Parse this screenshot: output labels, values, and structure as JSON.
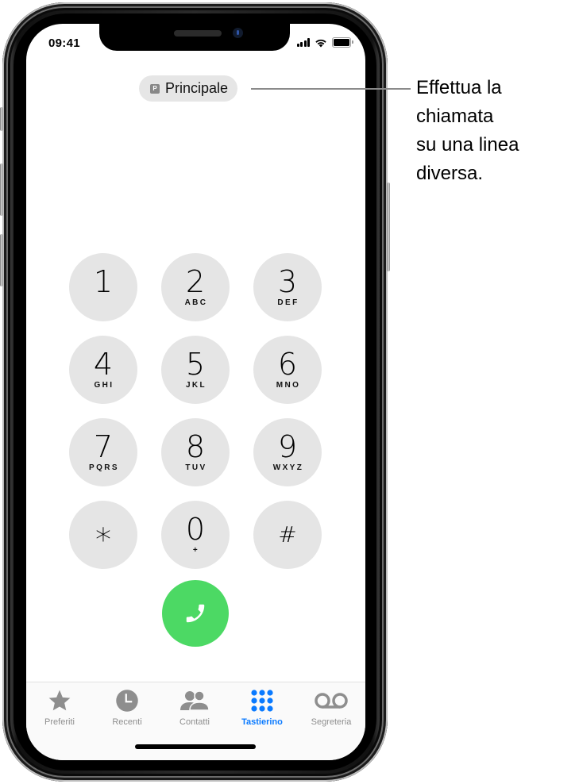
{
  "status_bar": {
    "time": "09:41",
    "icons": [
      "signal-icon",
      "wifi-icon",
      "battery-icon"
    ]
  },
  "line_selector": {
    "badge": "P",
    "label": "Principale"
  },
  "keypad": {
    "keys": [
      {
        "digit": "1",
        "letters": ""
      },
      {
        "digit": "2",
        "letters": "ABC"
      },
      {
        "digit": "3",
        "letters": "DEF"
      },
      {
        "digit": "4",
        "letters": "GHI"
      },
      {
        "digit": "5",
        "letters": "JKL"
      },
      {
        "digit": "6",
        "letters": "MNO"
      },
      {
        "digit": "7",
        "letters": "PQRS"
      },
      {
        "digit": "8",
        "letters": "TUV"
      },
      {
        "digit": "9",
        "letters": "WXYZ"
      },
      {
        "digit": "*",
        "letters": ""
      },
      {
        "digit": "0",
        "letters": "+"
      },
      {
        "digit": "#",
        "letters": ""
      }
    ]
  },
  "call_button": {
    "icon": "phone-icon",
    "color": "#4cd964"
  },
  "tabbar": {
    "active_color": "#0a7aff",
    "inactive_color": "#8e8e8e",
    "tabs": [
      {
        "label": "Preferiti",
        "icon": "star-icon",
        "active": false
      },
      {
        "label": "Recenti",
        "icon": "clock-icon",
        "active": false
      },
      {
        "label": "Contatti",
        "icon": "contacts-icon",
        "active": false
      },
      {
        "label": "Tastierino",
        "icon": "keypad-icon",
        "active": true
      },
      {
        "label": "Segreteria",
        "icon": "voicemail-icon",
        "active": false
      }
    ]
  },
  "callout": {
    "text": "Effettua la\nchiamata\nsu una linea\ndiversa."
  }
}
